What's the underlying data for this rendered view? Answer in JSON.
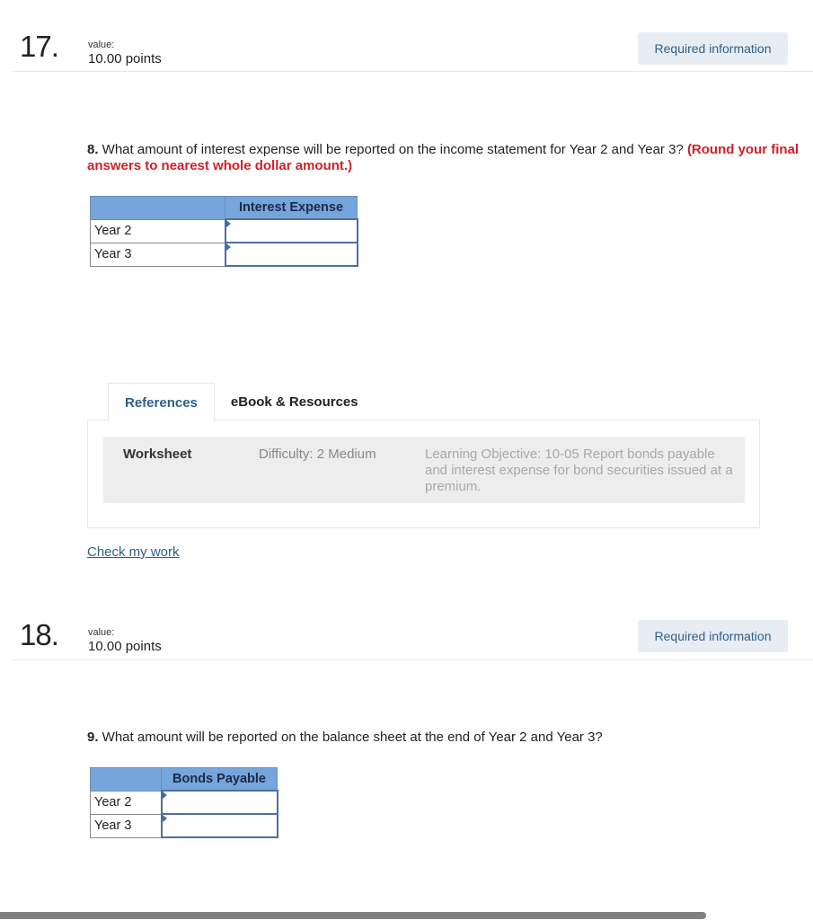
{
  "questions": [
    {
      "number": "17.",
      "value_label": "value:",
      "points": "10.00 points",
      "required_button": "Required information",
      "prompt_number": "8.",
      "prompt_text": " What amount of interest expense will be reported on the income statement for Year 2 and Year 3? ",
      "prompt_note": "(Round your final answers to nearest whole dollar amount.)",
      "table": {
        "column_header": "Interest Expense",
        "rows": [
          {
            "label": "Year 2",
            "value": ""
          },
          {
            "label": "Year 3",
            "value": ""
          }
        ]
      },
      "references": {
        "tabs": [
          "References",
          "eBook & Resources"
        ],
        "active_tab": "References",
        "worksheet": "Worksheet",
        "difficulty": "Difficulty: 2 Medium",
        "learning_objective": "Learning Objective: 10-05 Report bonds payable and interest expense for bond securities issued at a premium."
      },
      "check_link": "Check my work"
    },
    {
      "number": "18.",
      "value_label": "value:",
      "points": "10.00 points",
      "required_button": "Required information",
      "prompt_number": "9.",
      "prompt_text": " What amount will be reported on the balance sheet at the end of Year 2 and Year 3?",
      "table": {
        "column_header": "Bonds Payable",
        "rows": [
          {
            "label": "Year 2",
            "value": ""
          },
          {
            "label": "Year 3",
            "value": ""
          }
        ]
      }
    }
  ]
}
